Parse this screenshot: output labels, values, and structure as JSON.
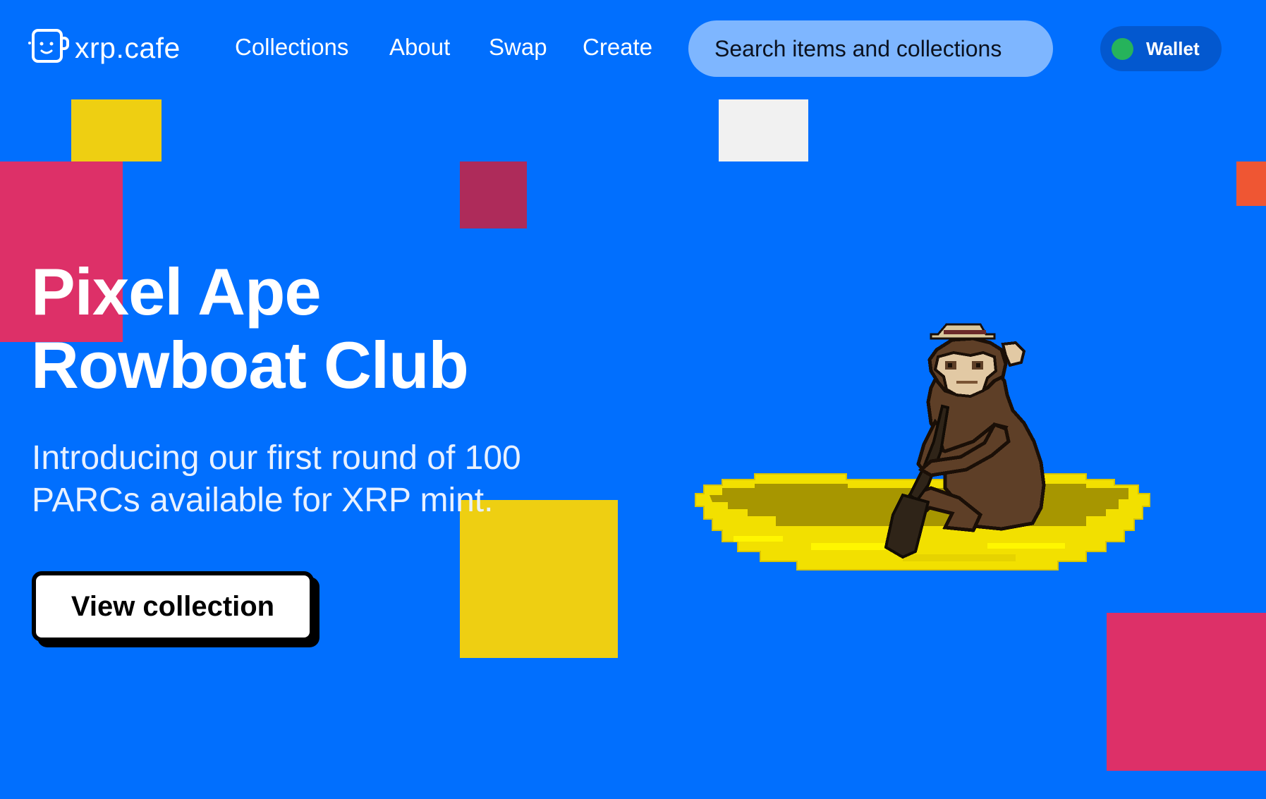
{
  "header": {
    "logo_text": "xrp.cafe",
    "nav": [
      {
        "label": "Collections"
      },
      {
        "label": "About"
      },
      {
        "label": "Swap"
      },
      {
        "label": "Create"
      }
    ],
    "search_placeholder": "Search items and collections",
    "wallet_label": "Wallet"
  },
  "hero": {
    "title_line1": "Pixel Ape",
    "title_line2": "Rowboat Club",
    "subtitle_line1": "Introducing our first round of 100",
    "subtitle_line2": "PARCs available for XRP mint.",
    "cta_label": "View collection"
  },
  "colors": {
    "background": "#016ffe",
    "search_bg": "#7eb6ff",
    "wallet_bg": "#0358cf",
    "wallet_status": "#26b35b",
    "yellow": "#eecf12",
    "pink": "#dd3068",
    "maroon": "#ae2b5a",
    "orange": "#ef5633",
    "white_square": "#f1f1f1"
  },
  "icons": {
    "logo": "coffee-cup-face-icon"
  }
}
